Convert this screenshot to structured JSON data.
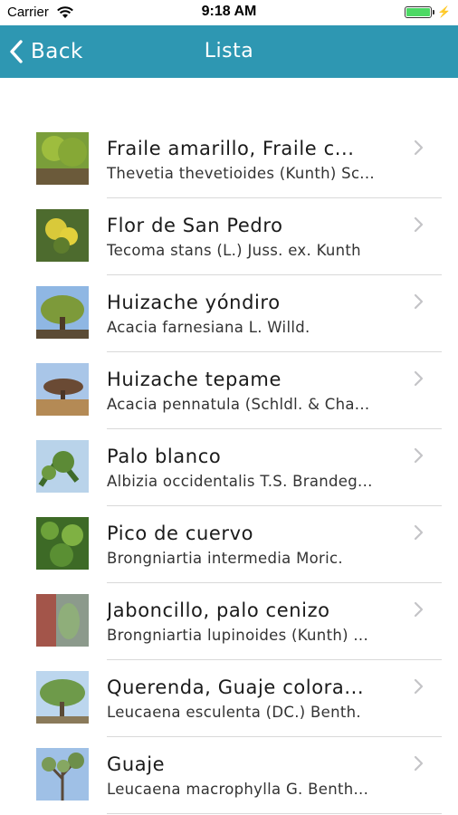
{
  "status_bar": {
    "carrier": "Carrier",
    "time": "9:18 AM",
    "battery_level": 1.0,
    "icons": [
      "wifi-icon",
      "battery-icon",
      "charging-icon"
    ]
  },
  "nav": {
    "back_label": "Back",
    "title": "Lista",
    "background_color": "#2e97b2"
  },
  "items": [
    {
      "common": "Fraile amarillo, Fraile c...",
      "scientific": "Thevetia thevetioides (Kunth) Sc...",
      "thumb_icon": "plant-photo"
    },
    {
      "common": "Flor de San Pedro",
      "scientific": "Tecoma stans (L.) Juss. ex. Kunth",
      "thumb_icon": "plant-photo"
    },
    {
      "common": "Huizache yóndiro",
      "scientific": "Acacia farnesiana L. Willd.",
      "thumb_icon": "plant-photo"
    },
    {
      "common": "Huizache tepame",
      "scientific": "Acacia pennatula (Schldl. & Cha...",
      "thumb_icon": "plant-photo"
    },
    {
      "common": "Palo blanco",
      "scientific": "Albizia occidentalis T.S. Brandeg...",
      "thumb_icon": "plant-photo"
    },
    {
      "common": "Pico de cuervo",
      "scientific": "Brongniartia intermedia Moric.",
      "thumb_icon": "plant-photo"
    },
    {
      "common": "Jaboncillo, palo cenizo",
      "scientific": "Brongniartia lupinoides (Kunth) ...",
      "thumb_icon": "plant-photo"
    },
    {
      "common": "Querenda, Guaje colora...",
      "scientific": "Leucaena esculenta (DC.) Benth.",
      "thumb_icon": "plant-photo"
    },
    {
      "common": "Guaje",
      "scientific": "Leucaena macrophylla G. Benth...",
      "thumb_icon": "plant-photo"
    }
  ]
}
